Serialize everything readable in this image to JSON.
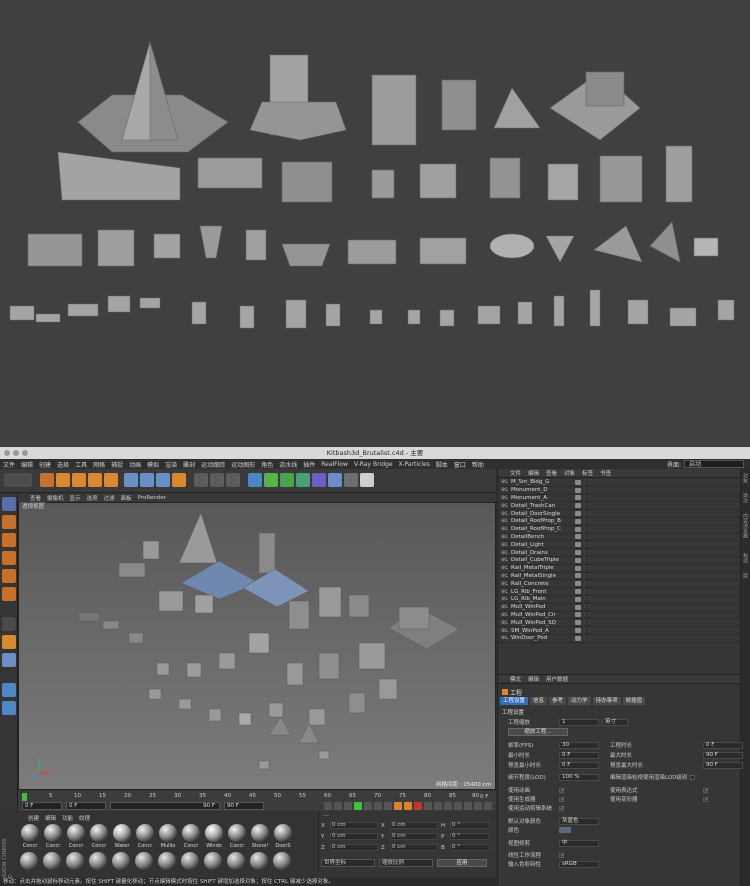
{
  "window": {
    "title": "Kitbash3d_Brutalist.c4d - 主要"
  },
  "menubar": {
    "items": [
      "文件",
      "编辑",
      "创建",
      "选择",
      "工具",
      "网格",
      "捕捉",
      "动画",
      "模拟",
      "渲染",
      "雕刻",
      "运动跟踪",
      "运动图形",
      "角色",
      "流水线",
      "插件",
      "RealFlow",
      "V-Ray Bridge",
      "X-Particles",
      "脚本",
      "窗口",
      "帮助"
    ],
    "layout_label": "界面:",
    "layout_value": "启动"
  },
  "viewport": {
    "menu": [
      "查看",
      "摄像机",
      "显示",
      "选项",
      "过滤",
      "面板",
      "ProRender"
    ],
    "label": "透视视图",
    "grid_info": "网格间距 : 25400 cm"
  },
  "timeline": {
    "ticks": [
      "0",
      "5",
      "10",
      "15",
      "20",
      "25",
      "30",
      "35",
      "40",
      "45",
      "50",
      "55",
      "60",
      "65",
      "70",
      "75",
      "80",
      "85",
      "90"
    ],
    "end_label": "0 F",
    "start_field": "0 F",
    "current_field": "0 F",
    "min_field": "90 F",
    "max_field": "90 F"
  },
  "materials": {
    "menu": [
      "创建",
      "编辑",
      "功能",
      "纹理"
    ],
    "items": [
      "Concr",
      "Concr",
      "Concr",
      "Concr",
      "Water",
      "Concr",
      "Mullio",
      "Concr",
      "Windo",
      "Concr",
      "Stone!",
      "DoorS"
    ],
    "side_label": "MAXON CINEMA 4D"
  },
  "coords": {
    "header": "---",
    "rows": [
      {
        "l1": "X",
        "v1": "0 cm",
        "l2": "X",
        "v2": "0 cm",
        "l3": "H",
        "v3": "0 °"
      },
      {
        "l1": "Y",
        "v1": "0 cm",
        "l2": "Y",
        "v2": "0 cm",
        "l3": "P",
        "v3": "0 °"
      },
      {
        "l1": "Z",
        "v1": "0 cm",
        "l2": "Z",
        "v2": "0 cm",
        "l3": "B",
        "v3": "0 °"
      }
    ],
    "mode1": "世界坐标",
    "mode2": "缩放比例",
    "apply": "应用"
  },
  "objects": {
    "menu": [
      "文件",
      "编辑",
      "查看",
      "对象",
      "标签",
      "书签"
    ],
    "items": [
      "M_Sm_Bldg_G",
      "Monument_D",
      "Monument_A",
      "Detail_TrashCan",
      "Detail_DoorSingle",
      "Detail_RoofProp_B",
      "Detail_RoofProp_C",
      "DetailBench",
      "Detail_Light",
      "Detail_Drains",
      "Detail_CubeTriple",
      "Rail_MetalTriple",
      "Rail_MetalSingle",
      "Rail_Concrete",
      "LG_Rib_Front",
      "LG_Rib_Main",
      "Mull_WinPod",
      "Mull_WinPod_Cir",
      "Mull_WinPod_SQ",
      "SM_WinPod_A",
      "WinDoor_Pod"
    ]
  },
  "side_tabs": [
    "对象",
    "场次",
    "内容浏览器",
    "构造",
    "层"
  ],
  "attributes": {
    "menu": [
      "模式",
      "编辑",
      "用户数据"
    ],
    "title": "工程",
    "tabs": [
      "工程设置",
      "信息",
      "参考",
      "动力学",
      "待办事项",
      "帧插值"
    ],
    "section": "工程设置",
    "scale_label": "工程缩放",
    "scale_value": "1",
    "scale_unit": "英寸",
    "scale_button": "缩放工程...",
    "fps_label": "帧率(FPS)",
    "fps_value": "30",
    "project_time_label": "工程时长",
    "project_time_value": "0 F",
    "min_time_label": "最小时长",
    "min_time_value": "0 F",
    "max_time_label": "最大时长",
    "max_time_value": "90 F",
    "preview_min_label": "预览最小时长",
    "preview_min_value": "0 F",
    "preview_max_label": "预览最大时长",
    "preview_max_value": "90 F",
    "lod_label": "细节程度(LOD)",
    "lod_value": "100 %",
    "lod_check_label": "编辑渲染检视使用渲染LOD级别",
    "anim_label": "使用动画",
    "expr_label": "使用表达式",
    "gen_label": "使用生成器",
    "deform_label": "使用变形器",
    "motion_label": "使用运动剪辑系统",
    "default_color_label": "默认对象颜色",
    "default_color_value": "灰蓝色",
    "color_label": "颜色",
    "view_clip_label": "视图修剪",
    "view_clip_value": "中",
    "linear_label": "线性工作流程",
    "input_color_label": "输入色彩特性",
    "input_color_value": "sRGB"
  },
  "statusbar": {
    "text": "移动：点击并拖动鼠标移动元素。按住 SHIFT 键量化移动；节点编辑模式时按住 SHIFT 键增加选择对象；按住 CTRL 键减少选择对象。"
  }
}
